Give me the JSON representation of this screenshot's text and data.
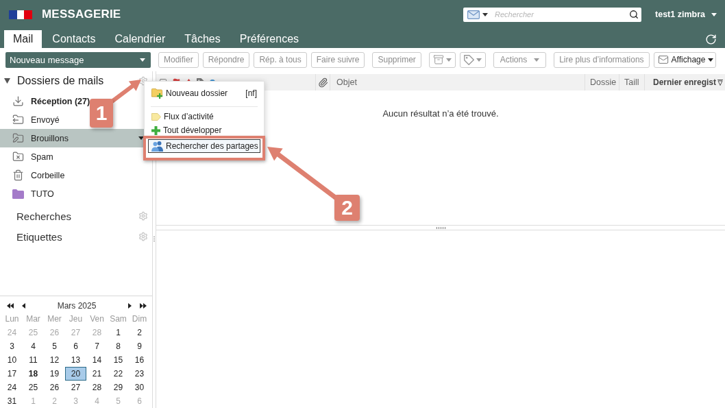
{
  "header": {
    "title": "MESSAGERIE",
    "search": {
      "placeholder": "Rechercher"
    },
    "user": "test1 zimbra"
  },
  "tabs": [
    {
      "label": "Mail",
      "selected": true
    },
    {
      "label": "Contacts",
      "selected": false
    },
    {
      "label": "Calendrier",
      "selected": false
    },
    {
      "label": "Tâches",
      "selected": false
    },
    {
      "label": "Préférences",
      "selected": false
    }
  ],
  "toolbar_groups": [
    [
      {
        "kind": "primary",
        "label": "Nouveau message",
        "disabled": false
      }
    ],
    [
      {
        "kind": "text",
        "label": "Modifier",
        "disabled": true
      },
      {
        "kind": "text",
        "label": "Répondre",
        "disabled": true
      },
      {
        "kind": "text",
        "label": "Rép. à tous",
        "disabled": true
      },
      {
        "kind": "text",
        "label": "Faire suivre",
        "disabled": true
      }
    ],
    [
      {
        "kind": "text",
        "label": "Supprimer",
        "disabled": true
      }
    ],
    [
      {
        "kind": "move",
        "disabled": true
      },
      {
        "kind": "tag",
        "disabled": true
      }
    ],
    [
      {
        "kind": "menu",
        "label": "Actions",
        "disabled": true
      }
    ],
    [
      {
        "kind": "text",
        "label": "Lire plus d’informations",
        "disabled": true
      },
      {
        "kind": "view",
        "label": "Affichage",
        "disabled": false
      }
    ]
  ],
  "folders": {
    "title": "Dossiers de mails",
    "expanded": true,
    "items": [
      {
        "kind": "inbox",
        "label": "Réception (27)",
        "unread": true,
        "selected": false
      },
      {
        "kind": "sent",
        "label": "Envoyé",
        "unread": false,
        "selected": false
      },
      {
        "kind": "drafts",
        "label": "Brouillons",
        "unread": false,
        "selected": true
      },
      {
        "kind": "spam",
        "label": "Spam",
        "unread": false,
        "selected": false
      },
      {
        "kind": "trash",
        "label": "Corbeille",
        "unread": false,
        "selected": false
      },
      {
        "kind": "folder",
        "label": "TUTO",
        "unread": false,
        "selected": false,
        "color": "#a47bc9"
      }
    ]
  },
  "sections": [
    {
      "label": "Recherches"
    },
    {
      "label": "Etiquettes"
    }
  ],
  "calendar": {
    "title": "Mars 2025",
    "weekdays": [
      "Lun",
      "Mar",
      "Mer",
      "Jeu",
      "Ven",
      "Sam",
      "Dim"
    ],
    "weeks": [
      [
        {
          "day": "24",
          "other_month": true,
          "today": false,
          "selected": false
        },
        {
          "day": "25",
          "other_month": true,
          "today": false,
          "selected": false
        },
        {
          "day": "26",
          "other_month": true,
          "today": false,
          "selected": false
        },
        {
          "day": "27",
          "other_month": true,
          "today": false,
          "selected": false
        },
        {
          "day": "28",
          "other_month": true,
          "today": false,
          "selected": false
        },
        {
          "day": "1",
          "other_month": false,
          "today": false,
          "selected": false
        },
        {
          "day": "2",
          "other_month": false,
          "today": false,
          "selected": false
        }
      ],
      [
        {
          "day": "3",
          "other_month": false,
          "today": false,
          "selected": false
        },
        {
          "day": "4",
          "other_month": false,
          "today": false,
          "selected": false
        },
        {
          "day": "5",
          "other_month": false,
          "today": false,
          "selected": false
        },
        {
          "day": "6",
          "other_month": false,
          "today": false,
          "selected": false
        },
        {
          "day": "7",
          "other_month": false,
          "today": false,
          "selected": false
        },
        {
          "day": "8",
          "other_month": false,
          "today": false,
          "selected": false
        },
        {
          "day": "9",
          "other_month": false,
          "today": false,
          "selected": false
        }
      ],
      [
        {
          "day": "10",
          "other_month": false,
          "today": false,
          "selected": false
        },
        {
          "day": "11",
          "other_month": false,
          "today": false,
          "selected": false
        },
        {
          "day": "12",
          "other_month": false,
          "today": false,
          "selected": false
        },
        {
          "day": "13",
          "other_month": false,
          "today": false,
          "selected": false
        },
        {
          "day": "14",
          "other_month": false,
          "today": false,
          "selected": false
        },
        {
          "day": "15",
          "other_month": false,
          "today": false,
          "selected": false
        },
        {
          "day": "16",
          "other_month": false,
          "today": false,
          "selected": false
        }
      ],
      [
        {
          "day": "17",
          "other_month": false,
          "today": false,
          "selected": false
        },
        {
          "day": "18",
          "other_month": false,
          "today": true,
          "selected": false
        },
        {
          "day": "19",
          "other_month": false,
          "today": false,
          "selected": false
        },
        {
          "day": "20",
          "other_month": false,
          "today": false,
          "selected": true
        },
        {
          "day": "21",
          "other_month": false,
          "today": false,
          "selected": false
        },
        {
          "day": "22",
          "other_month": false,
          "today": false,
          "selected": false
        },
        {
          "day": "23",
          "other_month": false,
          "today": false,
          "selected": false
        }
      ],
      [
        {
          "day": "24",
          "other_month": false,
          "today": false,
          "selected": false
        },
        {
          "day": "25",
          "other_month": false,
          "today": false,
          "selected": false
        },
        {
          "day": "26",
          "other_month": false,
          "today": false,
          "selected": false
        },
        {
          "day": "27",
          "other_month": false,
          "today": false,
          "selected": false
        },
        {
          "day": "28",
          "other_month": false,
          "today": false,
          "selected": false
        },
        {
          "day": "29",
          "other_month": false,
          "today": false,
          "selected": false
        },
        {
          "day": "30",
          "other_month": false,
          "today": false,
          "selected": false
        }
      ],
      [
        {
          "day": "31",
          "other_month": false,
          "today": false,
          "selected": false
        },
        {
          "day": "1",
          "other_month": true,
          "today": false,
          "selected": false
        },
        {
          "day": "2",
          "other_month": true,
          "today": false,
          "selected": false
        },
        {
          "day": "3",
          "other_month": true,
          "today": false,
          "selected": false
        },
        {
          "day": "4",
          "other_month": true,
          "today": false,
          "selected": false
        },
        {
          "day": "5",
          "other_month": true,
          "today": false,
          "selected": false
        },
        {
          "day": "6",
          "other_month": true,
          "today": false,
          "selected": false
        }
      ]
    ]
  },
  "message_list": {
    "columns": [
      {
        "label": "Objet",
        "sorted": false
      },
      {
        "label": "Dossie",
        "sorted": false
      },
      {
        "label": "Taill",
        "sorted": false
      },
      {
        "label": "Dernier enregist",
        "sorted": true
      }
    ],
    "empty_text": "Aucun résultat n’a été trouvé."
  },
  "context_menu": {
    "groups": [
      [
        {
          "kind": "new-folder",
          "label": "Nouveau dossier",
          "shortcut": "[nf]",
          "selected": false
        }
      ],
      [
        {
          "kind": "activity",
          "label": "Flux d’activité",
          "selected": false
        },
        {
          "kind": "expand",
          "label": "Tout développer",
          "selected": false
        },
        {
          "kind": "share",
          "label": "Rechercher des partages",
          "selected": true
        }
      ]
    ]
  },
  "annotations": [
    {
      "kind": "callout",
      "label": "1"
    },
    {
      "kind": "callout",
      "label": "2"
    },
    {
      "kind": "frame"
    }
  ]
}
